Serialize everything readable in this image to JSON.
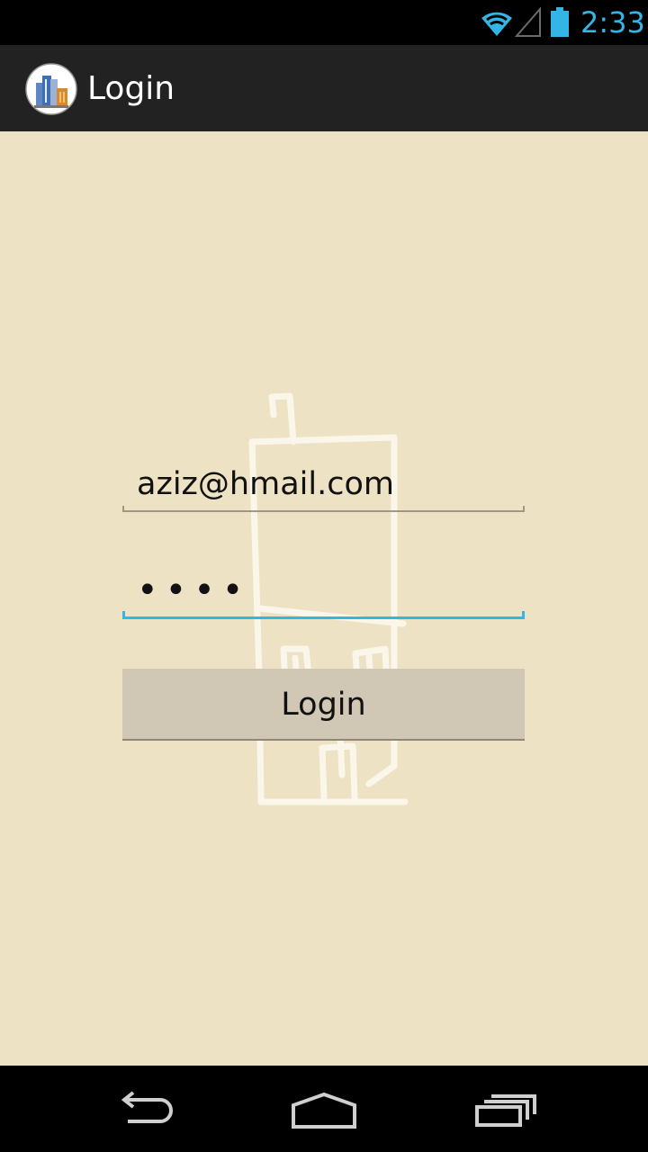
{
  "status_bar": {
    "time": "2:33",
    "icons": [
      "wifi-icon",
      "signal-icon",
      "battery-icon"
    ],
    "accent_color": "#33b5e5"
  },
  "action_bar": {
    "title": "Login",
    "app_icon": "buildings-icon"
  },
  "form": {
    "email_value": "aziz@hmail.com",
    "password_value": "••••",
    "login_label": "Login",
    "focused_field": "password"
  },
  "navigation": {
    "buttons": [
      "back-icon",
      "home-icon",
      "recent-apps-icon"
    ]
  },
  "colors": {
    "background": "#eee2c5",
    "action_bar": "#222222",
    "button": "#d0c8b4",
    "focus_underline": "#33b5e5"
  }
}
